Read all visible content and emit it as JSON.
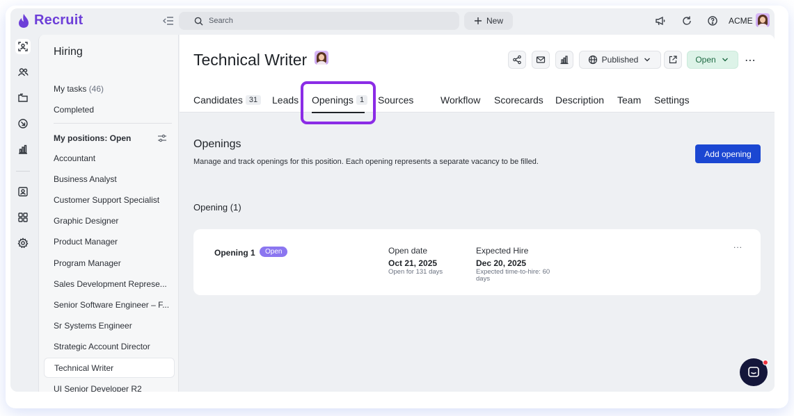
{
  "app": {
    "name": "Recruit",
    "brand_color": "#6d3fd8"
  },
  "topbar": {
    "search_placeholder": "Search",
    "new_label": "New",
    "org_name": "ACME"
  },
  "sidebar": {
    "title": "Hiring",
    "my_tasks_label": "My tasks",
    "my_tasks_count": "(46)",
    "completed_label": "Completed",
    "section_label": "My positions: Open",
    "positions": [
      {
        "label": "Accountant"
      },
      {
        "label": "Business Analyst"
      },
      {
        "label": "Customer Support Specialist"
      },
      {
        "label": "Graphic Designer"
      },
      {
        "label": "Product Manager"
      },
      {
        "label": "Program Manager"
      },
      {
        "label": "Sales Development Represe..."
      },
      {
        "label": "Senior Software Engineer – F..."
      },
      {
        "label": "Sr Systems Engineer"
      },
      {
        "label": "Strategic Account Director"
      },
      {
        "label": "Technical Writer",
        "active": true
      },
      {
        "label": "UI Senior Developer R2"
      }
    ]
  },
  "position": {
    "title": "Technical Writer",
    "published_label": "Published",
    "open_label": "Open",
    "more_label": "⋯"
  },
  "tabs": [
    {
      "label": "Candidates",
      "count": "31"
    },
    {
      "label": "Leads"
    },
    {
      "label": "Openings",
      "count": "1",
      "active": true
    },
    {
      "label": "Sources"
    },
    {
      "label": "Workflow"
    },
    {
      "label": "Scorecards"
    },
    {
      "label": "Description"
    },
    {
      "label": "Team"
    },
    {
      "label": "Settings"
    }
  ],
  "openings": {
    "title": "Openings",
    "description": "Manage and track openings for this position. Each opening represents a separate vacancy to be filled.",
    "add_label": "Add opening",
    "section_label": "Opening (1)",
    "items": [
      {
        "name": "Opening 1",
        "status": "Open",
        "open_date_label": "Open date",
        "open_date": "Oct 21, 2025",
        "open_for": "Open for 131 days",
        "expected_hire_label": "Expected Hire",
        "expected_hire": "Dec 20, 2025",
        "time_to_hire_line1": "Expected time-to-hire: 60",
        "time_to_hire_line2": "days",
        "more_label": "..."
      }
    ]
  },
  "colors": {
    "primary_button": "#1b47d2",
    "open_status_badge": "#8b76f0",
    "open_button_bg": "#ddf3e8",
    "tab_highlight": "#8b2ce6",
    "chat_bubble": "#14163a",
    "notification_dot": "#ef3340"
  }
}
